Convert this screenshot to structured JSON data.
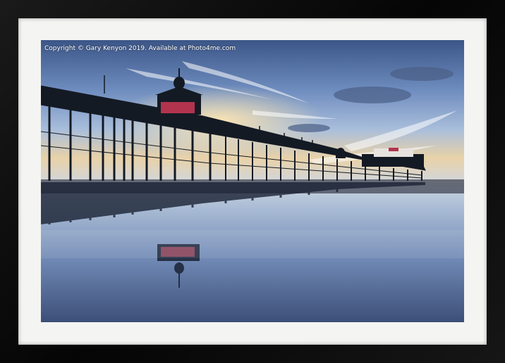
{
  "watermark": {
    "text": "Copyright  © Gary Kenyon  2019. Available at Photo4me.com"
  },
  "scene": {
    "subject": "seaside pier at sunset with reflection on wet sand",
    "colors": {
      "frame": "#0e0e0e",
      "mount": "#f4f4f2",
      "sky_top": "#3d5a8c",
      "sky_mid": "#7d9cc8",
      "sky_glow": "#f2c98a",
      "pier": "#141a24"
    }
  }
}
